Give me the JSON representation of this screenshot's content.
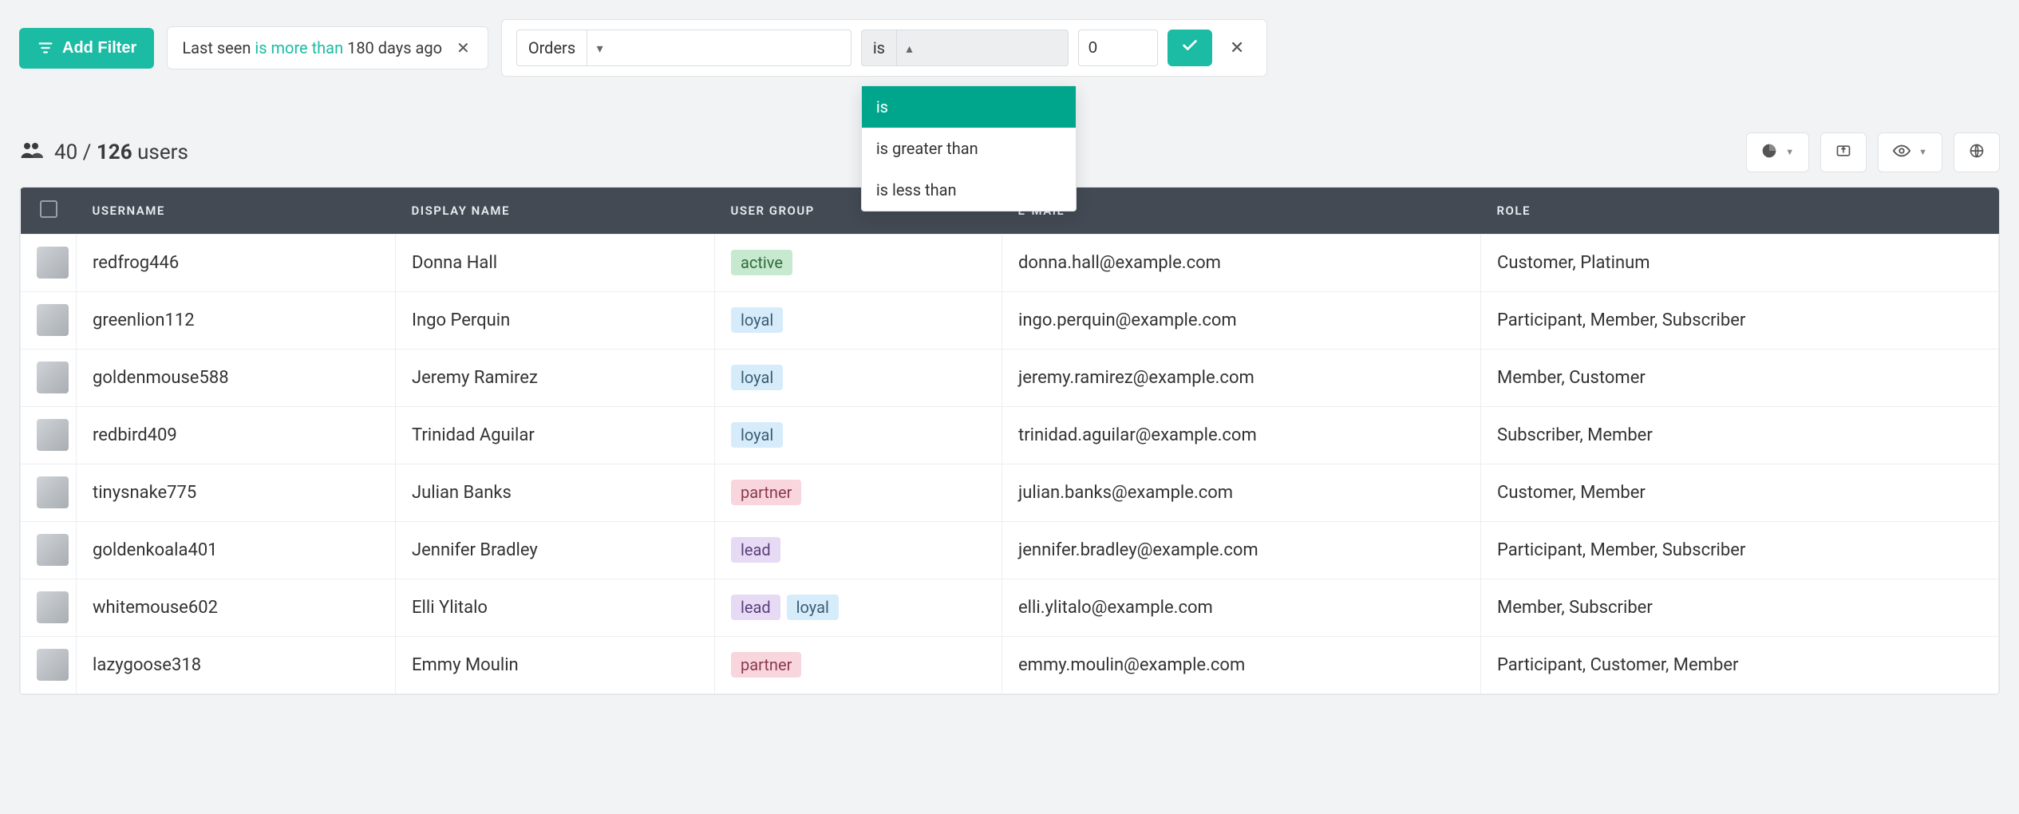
{
  "toolbar": {
    "add_filter_label": "Add Filter",
    "chip": {
      "field": "Last seen",
      "operator": "is more than",
      "value": "180 days ago"
    },
    "editor": {
      "field": "Orders",
      "operator": "is",
      "value": "0",
      "options": [
        "is",
        "is greater than",
        "is less than"
      ]
    }
  },
  "count": {
    "shown": "40",
    "total": "126",
    "label": "users"
  },
  "columns": {
    "username": "USERNAME",
    "display_name": "DISPLAY NAME",
    "user_group": "USER GROUP",
    "email": "E-MAIL",
    "role": "ROLE"
  },
  "group_labels": {
    "active": "active",
    "loyal": "loyal",
    "partner": "partner",
    "lead": "lead"
  },
  "rows": [
    {
      "username": "redfrog446",
      "display_name": "Donna Hall",
      "groups": [
        "active"
      ],
      "email": "donna.hall@example.com",
      "role": "Customer, Platinum"
    },
    {
      "username": "greenlion112",
      "display_name": "Ingo Perquin",
      "groups": [
        "loyal"
      ],
      "email": "ingo.perquin@example.com",
      "role": "Participant, Member, Subscriber"
    },
    {
      "username": "goldenmouse588",
      "display_name": "Jeremy Ramirez",
      "groups": [
        "loyal"
      ],
      "email": "jeremy.ramirez@example.com",
      "role": "Member, Customer"
    },
    {
      "username": "redbird409",
      "display_name": "Trinidad Aguilar",
      "groups": [
        "loyal"
      ],
      "email": "trinidad.aguilar@example.com",
      "role": "Subscriber, Member"
    },
    {
      "username": "tinysnake775",
      "display_name": "Julian Banks",
      "groups": [
        "partner"
      ],
      "email": "julian.banks@example.com",
      "role": "Customer, Member"
    },
    {
      "username": "goldenkoala401",
      "display_name": "Jennifer Bradley",
      "groups": [
        "lead"
      ],
      "email": "jennifer.bradley@example.com",
      "role": "Participant, Member, Subscriber"
    },
    {
      "username": "whitemouse602",
      "display_name": "Elli Ylitalo",
      "groups": [
        "lead",
        "loyal"
      ],
      "email": "elli.ylitalo@example.com",
      "role": "Member, Subscriber"
    },
    {
      "username": "lazygoose318",
      "display_name": "Emmy Moulin",
      "groups": [
        "partner"
      ],
      "email": "emmy.moulin@example.com",
      "role": "Participant, Customer, Member"
    }
  ]
}
